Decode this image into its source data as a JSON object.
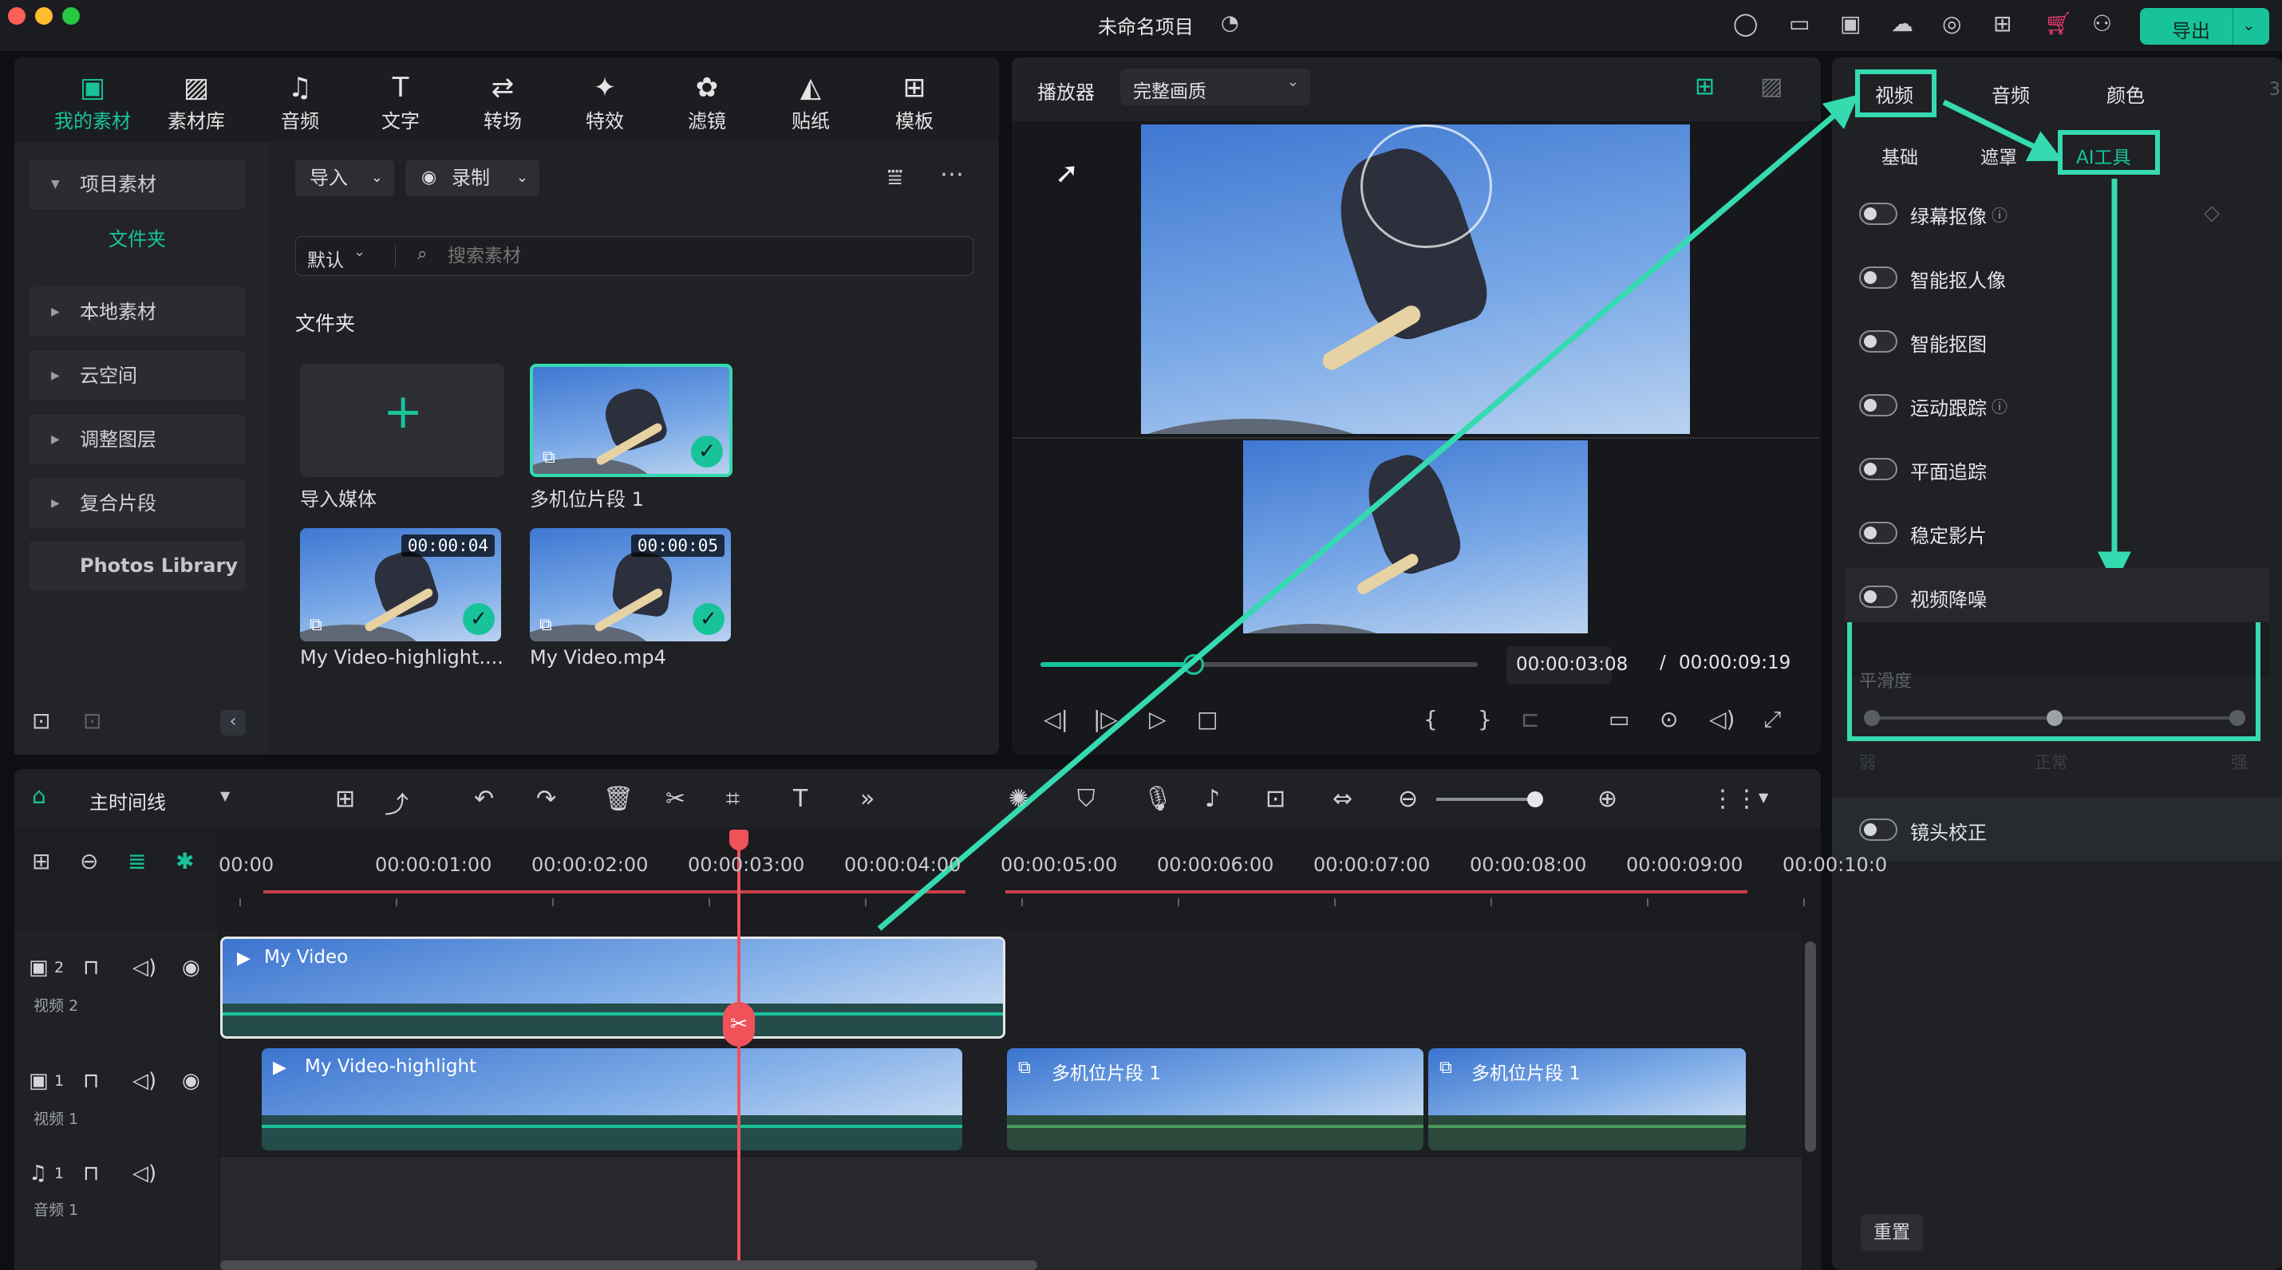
{
  "window": {
    "title": "未命名项目"
  },
  "header": {
    "export_label": "导出"
  },
  "media_tabs": [
    {
      "label": "我的素材",
      "icon": "my-media-icon",
      "active": true
    },
    {
      "label": "素材库",
      "icon": "stock-library-icon"
    },
    {
      "label": "音频",
      "icon": "audio-icon"
    },
    {
      "label": "文字",
      "icon": "text-icon"
    },
    {
      "label": "转场",
      "icon": "transition-icon"
    },
    {
      "label": "特效",
      "icon": "effects-icon"
    },
    {
      "label": "滤镜",
      "icon": "filters-icon"
    },
    {
      "label": "贴纸",
      "icon": "stickers-icon"
    },
    {
      "label": "模板",
      "icon": "templates-icon"
    }
  ],
  "sidebar": {
    "project_media": "项目素材",
    "folder": "文件夹",
    "items": [
      "本地素材",
      "云空间",
      "调整图层",
      "复合片段"
    ],
    "photos_library": "Photos Library"
  },
  "media_toolbar": {
    "import": "导入",
    "record": "录制",
    "sort": "默认",
    "search_placeholder": "搜索素材"
  },
  "media_grid": {
    "section": "文件夹",
    "import_label": "导入媒体",
    "items": [
      {
        "name": "多机位片段 1",
        "duration": "",
        "selected": true
      },
      {
        "name": "My Video-highlight....",
        "duration": "00:00:04"
      },
      {
        "name": "My Video.mp4",
        "duration": "00:00:05"
      }
    ]
  },
  "player": {
    "label": "播放器",
    "quality": "完整画质",
    "current_time": "00:00:03:08",
    "separator": "/",
    "total_time": "00:00:09:19",
    "progress": 0.35
  },
  "right_panel": {
    "tabs": [
      "视频",
      "音频",
      "颜色"
    ],
    "subtabs": [
      "基础",
      "遮罩",
      "AI工具"
    ],
    "options": [
      "绿幕抠像",
      "智能抠人像",
      "智能抠图",
      "运动跟踪",
      "平面追踪",
      "稳定影片",
      "视频降噪"
    ],
    "smoothness": {
      "label": "平滑度",
      "ticks": [
        "弱",
        "正常",
        "强"
      ],
      "value": 0.5
    },
    "lens": "镜头校正",
    "reset": "重置"
  },
  "timeline": {
    "name": "主时间线",
    "ruler": [
      "00:00",
      "00:00:01:00",
      "00:00:02:00",
      "00:00:03:00",
      "00:00:04:00",
      "00:00:05:00",
      "00:00:06:00",
      "00:00:07:00",
      "00:00:08:00",
      "00:00:09:00",
      "00:00:10:0"
    ],
    "tracks": [
      {
        "num": "2",
        "label": "视频 2"
      },
      {
        "num": "1",
        "label": "视频 1"
      },
      {
        "num": "1",
        "label": "音频 1"
      }
    ],
    "clips": {
      "v2": "My Video",
      "v1a": "My Video-highlight",
      "v1b": "多机位片段 1",
      "v1c": "多机位片段 1"
    }
  },
  "colors": {
    "accent": "#19c39a",
    "annotation": "#35dab0",
    "playhead": "#f0525a"
  }
}
